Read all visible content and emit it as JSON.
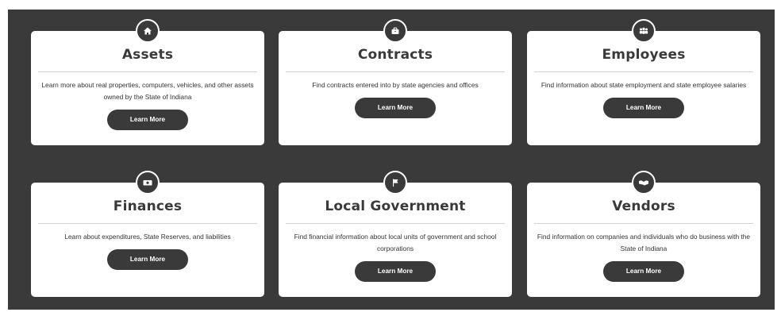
{
  "cards": [
    {
      "title": "Assets",
      "description": "Learn more about real properties, computers, vehicles, and other assets owned by the State of Indiana",
      "button": "Learn More",
      "icon": "home-icon"
    },
    {
      "title": "Contracts",
      "description": "Find contracts entered into by state agencies and offices",
      "button": "Learn More",
      "icon": "briefcase-icon"
    },
    {
      "title": "Employees",
      "description": "Find information about state employment and state employee salaries",
      "button": "Learn More",
      "icon": "people-icon"
    },
    {
      "title": "Finances",
      "description": "Learn about expenditures, State Reserves, and liabilities",
      "button": "Learn More",
      "icon": "money-icon"
    },
    {
      "title": "Local Government",
      "description": "Find financial information about local units of government and school corporations",
      "button": "Learn More",
      "icon": "flag-icon"
    },
    {
      "title": "Vendors",
      "description": "Find information on companies and individuals who do business with the State of Indiana",
      "button": "Learn More",
      "icon": "handshake-icon"
    }
  ],
  "colors": {
    "panel": "#3a3a3a",
    "card": "#ffffff",
    "button": "#3a3a3a",
    "button_text": "#ffffff"
  }
}
